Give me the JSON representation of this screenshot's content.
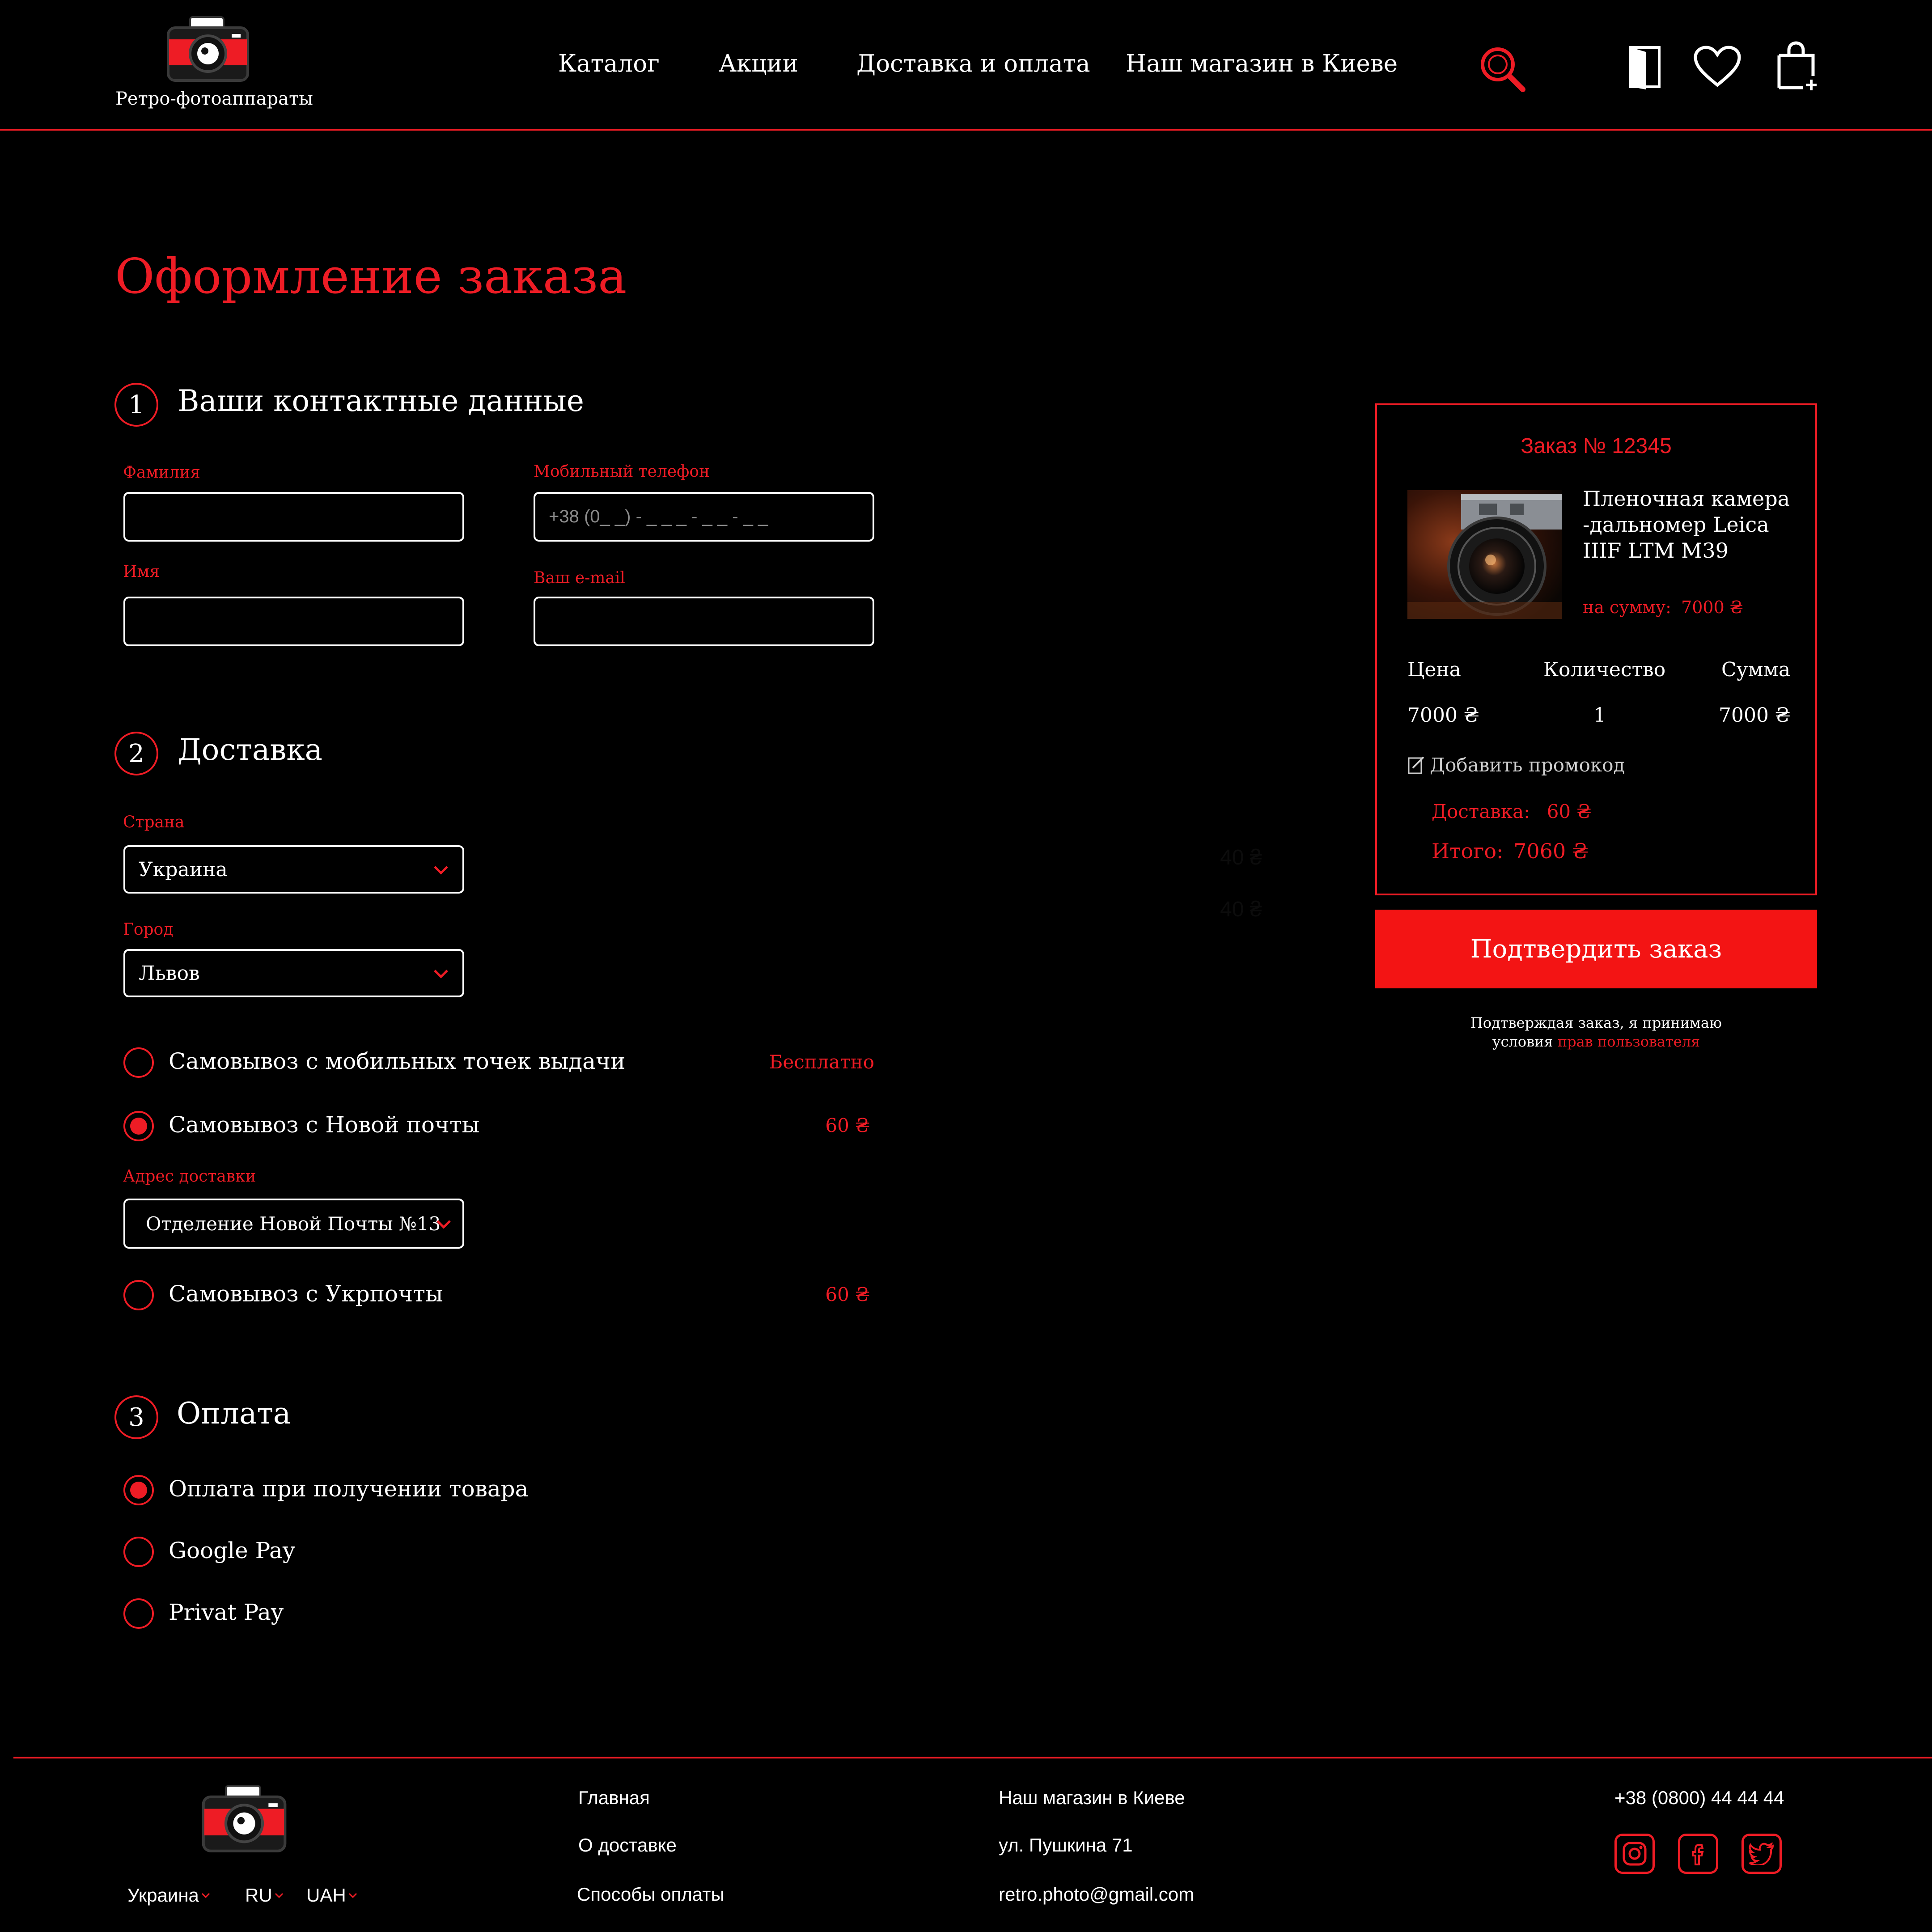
{
  "header": {
    "logo_text": "Ретро-фотоаппараты",
    "nav": [
      "Каталог",
      "Акции",
      "Доставка и оплата",
      "Наш магазин в Киеве"
    ]
  },
  "page": {
    "title": "Оформление заказа"
  },
  "contacts": {
    "step": "1",
    "title": "Ваши контактные данные",
    "surname_label": "Фамилия",
    "name_label": "Имя",
    "phone_label": "Мобильный телефон",
    "phone_placeholder": "+38 (0_ _) - _ _ _ - _ _ - _ _",
    "email_label": "Ваш e-mail",
    "surname_value": "",
    "name_value": "",
    "email_value": ""
  },
  "delivery": {
    "step": "2",
    "title": "Доставка",
    "country_label": "Страна",
    "country_value": "Украина",
    "city_label": "Город",
    "city_value": "Львов",
    "faint_price_1": "40 ₴",
    "faint_price_2": "40 ₴",
    "options": [
      {
        "label": "Самовывоз с мобильных точек выдачи",
        "price": "Бесплатно",
        "selected": false
      },
      {
        "label": "Самовывоз с Новой почты",
        "price": "60 ₴",
        "selected": true
      },
      {
        "label": "Самовывоз с Укрпочты",
        "price": "60 ₴",
        "selected": false
      }
    ],
    "address_label": "Адрес доставки",
    "address_value": "Отделение Новой Почты №13"
  },
  "payment": {
    "step": "3",
    "title": "Оплата",
    "options": [
      {
        "label": "Оплата при получении товара",
        "selected": true
      },
      {
        "label": "Google Pay",
        "selected": false
      },
      {
        "label": "Privat Pay",
        "selected": false
      }
    ]
  },
  "order": {
    "title": "Заказ № 12345",
    "product_name_lines": [
      "Пленочная камера",
      "-дальномер Leica",
      "IIIF LTM M39"
    ],
    "sum_label": "на сумму:",
    "sum_value": "7000 ₴",
    "col_price": "Цена",
    "col_qty": "Количество",
    "col_total": "Сумма",
    "price": "7000 ₴",
    "qty": "1",
    "total": "7000 ₴",
    "promo": "Добавить промокод",
    "delivery_label": "Доставка:",
    "delivery_value": "60 ₴",
    "grand_label": "Итого:",
    "grand_value": "7060 ₴",
    "confirm_label": "Подтвердить заказ",
    "terms_line1": "Подтверждая заказ, я принимаю",
    "terms_prefix": "условия ",
    "terms_link": "прав пользователя"
  },
  "footer": {
    "links_col1": [
      "Главная",
      "О доставке",
      "Способы оплаты"
    ],
    "links_col2": [
      "Наш магазин в Киеве",
      "ул. Пушкина 71",
      "retro.photo@gmail.com"
    ],
    "phone": "+38 (0800) 44 44 44",
    "selectors": [
      "Украина",
      "RU",
      "UAH"
    ],
    "social_icons": [
      "instagram-icon",
      "facebook-icon",
      "twitter-icon"
    ]
  },
  "colors": {
    "accent": "#ee1c25",
    "button": "#f31414",
    "background": "#000000",
    "text": "#ffffff"
  }
}
